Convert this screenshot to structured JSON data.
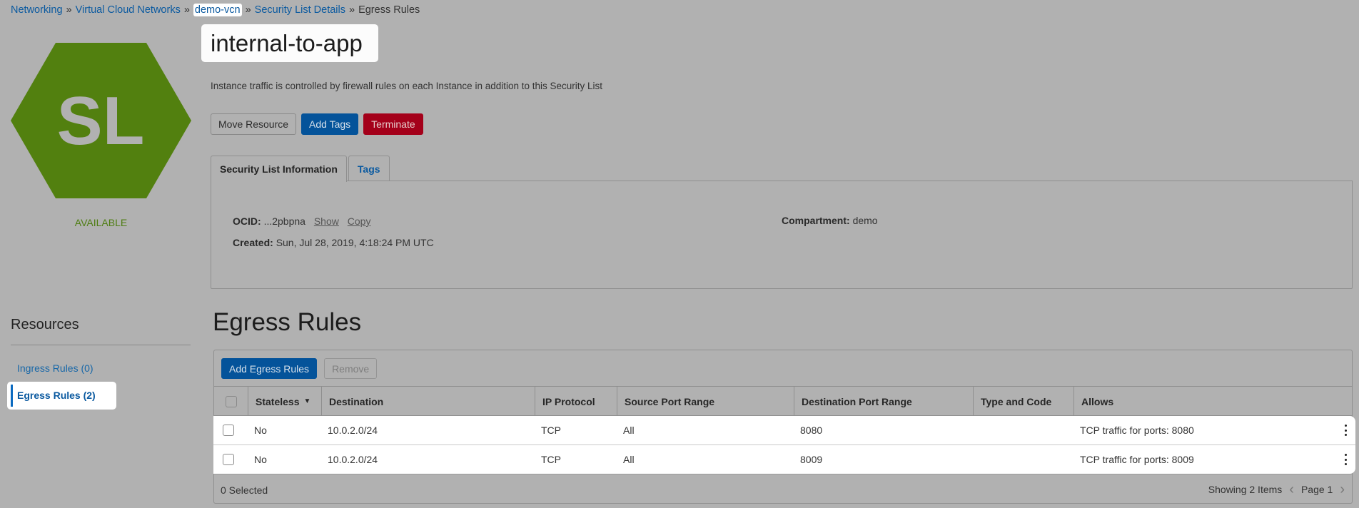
{
  "breadcrumb": {
    "items": [
      "Networking",
      "Virtual Cloud Networks",
      "demo-vcn",
      "Security List Details"
    ],
    "current": "Egress Rules",
    "separator": "»"
  },
  "resource": {
    "title": "internal-to-app",
    "icon_text": "SL",
    "icon_color": "#52800f",
    "status": "AVAILABLE",
    "description": "Instance traffic is controlled by firewall rules on each Instance in addition to this Security List"
  },
  "actions": {
    "move_resource": "Move Resource",
    "add_tags": "Add Tags",
    "terminate": "Terminate"
  },
  "tabs": {
    "info": "Security List Information",
    "tags": "Tags"
  },
  "info": {
    "ocid_label": "OCID:",
    "ocid_value": "...2pbpna",
    "show": "Show",
    "copy": "Copy",
    "created_label": "Created:",
    "created_value": "Sun, Jul 28, 2019, 4:18:24 PM UTC",
    "compartment_label": "Compartment:",
    "compartment_value": "demo"
  },
  "resources": {
    "title": "Resources",
    "ingress": "Ingress Rules (0)",
    "egress": "Egress Rules (2)"
  },
  "egress": {
    "title": "Egress Rules",
    "add_button": "Add Egress Rules",
    "remove_button": "Remove",
    "columns": [
      "Stateless",
      "Destination",
      "IP Protocol",
      "Source Port Range",
      "Destination Port Range",
      "Type and Code",
      "Allows"
    ],
    "rows": [
      {
        "stateless": "No",
        "destination": "10.0.2.0/24",
        "protocol": "TCP",
        "source_port": "All",
        "dest_port": "8080",
        "type_code": "",
        "allows": "TCP traffic for ports: 8080"
      },
      {
        "stateless": "No",
        "destination": "10.0.2.0/24",
        "protocol": "TCP",
        "source_port": "All",
        "dest_port": "8009",
        "type_code": "",
        "allows": "TCP traffic for ports: 8009"
      }
    ],
    "selected": "0 Selected",
    "showing": "Showing 2 Items",
    "page": "Page 1"
  }
}
